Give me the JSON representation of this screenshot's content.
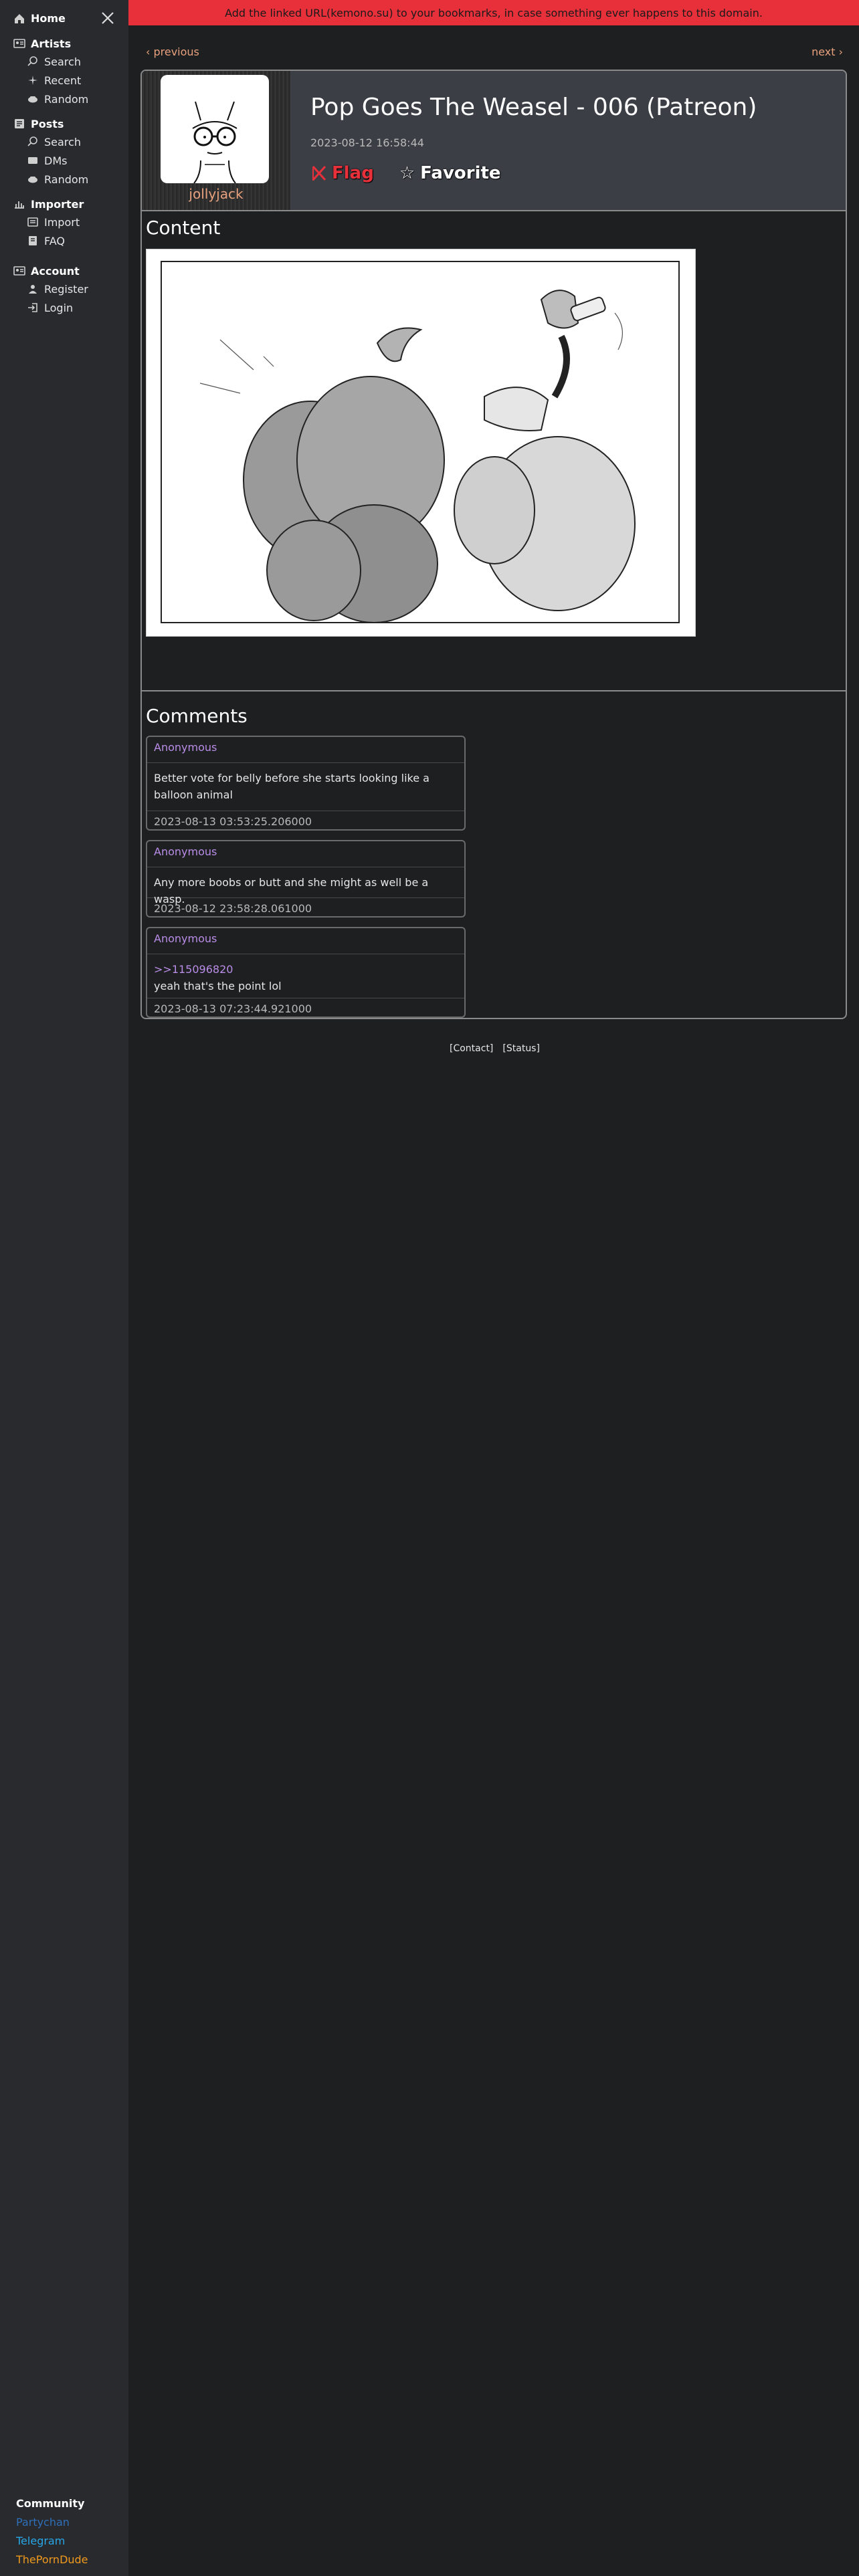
{
  "sidebar": {
    "home_label": "Home",
    "sections": [
      {
        "label": "Artists",
        "items": [
          "Search",
          "Recent",
          "Random"
        ]
      },
      {
        "label": "Posts",
        "items": [
          "Search",
          "DMs",
          "Random"
        ]
      },
      {
        "label": "Importer",
        "items": [
          "Import",
          "FAQ"
        ]
      },
      {
        "label": "Account",
        "items": [
          "Register",
          "Login"
        ]
      }
    ],
    "community": {
      "title": "Community",
      "links": [
        {
          "label": "Partychan",
          "color": "#2e6fb8"
        },
        {
          "label": "Telegram",
          "color": "#27a7e7"
        },
        {
          "label": "ThePornDude",
          "color": "#f29a1c"
        }
      ]
    }
  },
  "banner": {
    "text": "Add the linked URL(kemono.su) to your bookmarks, in case something ever happens to this domain."
  },
  "nav": {
    "previous": "‹ previous",
    "next": "next ›"
  },
  "post": {
    "artist": "jollyjack",
    "title": "Pop Goes The Weasel - 006 (Patreon)",
    "date": "2023-08-12 16:58:44",
    "flag_label": "Flag",
    "favorite_label": "Favorite",
    "content_heading": "Content",
    "comments_heading": "Comments"
  },
  "comments": [
    {
      "author": "Anonymous",
      "reply_ref": "",
      "text": "Better vote for belly before she starts looking like a balloon animal",
      "date": "2023-08-13 03:53:25.206000"
    },
    {
      "author": "Anonymous",
      "reply_ref": "",
      "text": "Any more boobs or butt and she might as well be a wasp.",
      "date": "2023-08-12 23:58:28.061000"
    },
    {
      "author": "Anonymous",
      "reply_ref": ">>115096820",
      "text": "yeah that's the point lol",
      "date": "2023-08-13 07:23:44.921000"
    }
  ],
  "footer": {
    "contact": "[Contact]",
    "status": "[Status]"
  },
  "colors": {
    "banner": "#e8303b",
    "accent_link": "#e8a17d",
    "comment_author": "#b98de8"
  }
}
